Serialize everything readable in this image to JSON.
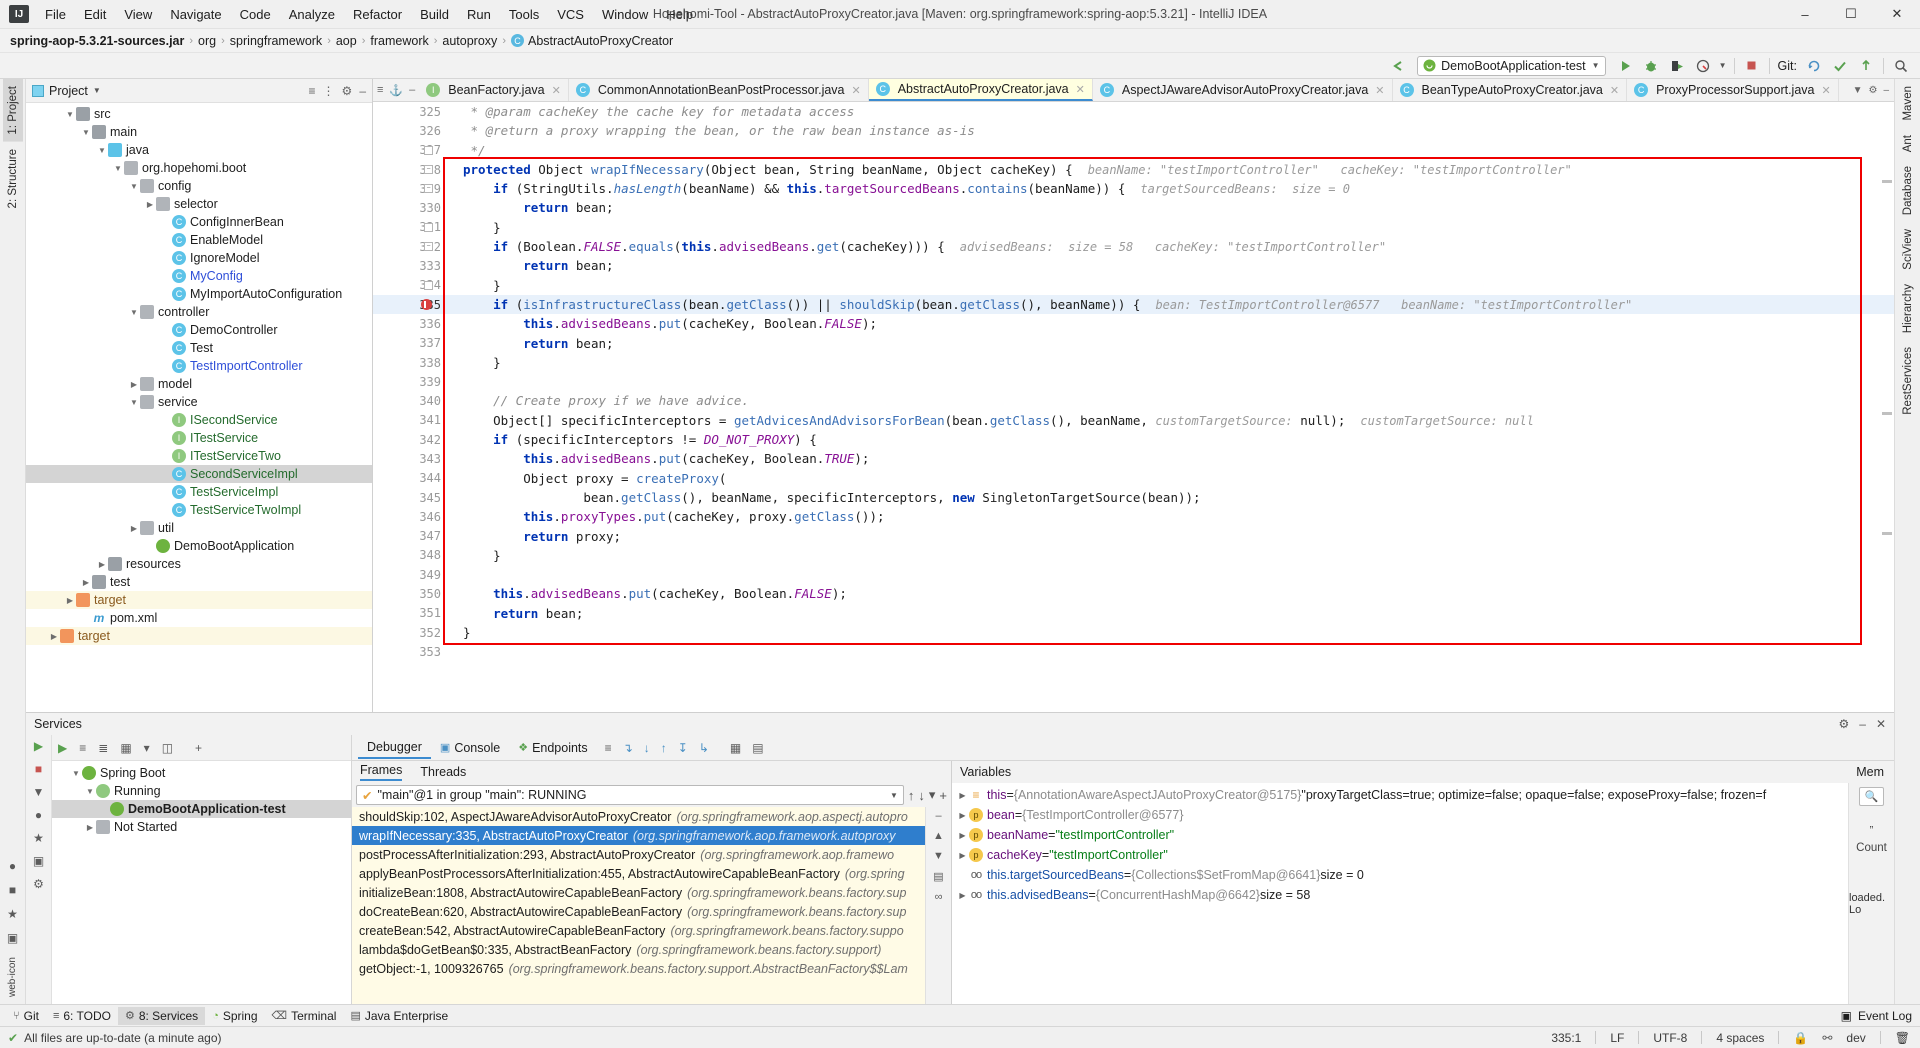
{
  "window": {
    "title": "Hopehomi-Tool - AbstractAutoProxyCreator.java [Maven: org.springframework:spring-aop:5.3.21] - IntelliJ IDEA",
    "minimize": "–",
    "maximize": "☐",
    "close": "✕"
  },
  "menu": [
    "File",
    "Edit",
    "View",
    "Navigate",
    "Code",
    "Analyze",
    "Refactor",
    "Build",
    "Run",
    "Tools",
    "VCS",
    "Window",
    "Help"
  ],
  "breadcrumb": {
    "root": "spring-aop-5.3.21-sources.jar",
    "items": [
      "org",
      "springframework",
      "aop",
      "framework",
      "autoproxy"
    ],
    "leaf": "AbstractAutoProxyCreator",
    "leaf_icon": "class-icon",
    "separator": "›"
  },
  "toolbar": {
    "run_config": "DemoBootApplication-test",
    "run_config_icon": "spring-boot-icon",
    "git_label": "Git:",
    "back_icon": "back-arrow-icon",
    "run_icon": "run-icon",
    "debug_icon": "debug-icon",
    "run_coverage_icon": "run-coverage-icon",
    "profile_icon": "profiler-icon",
    "stop_icon": "stop-icon",
    "update_icon": "update-project-icon",
    "commit_icon": "commit-icon",
    "push_icon": "push-icon",
    "search_icon": "search-everywhere-icon"
  },
  "project_pane": {
    "title": "Project",
    "caret": "▼",
    "tree": [
      {
        "label": "src",
        "indent": 2,
        "twist": "▼",
        "icon": "folder-icon",
        "color": "plain"
      },
      {
        "label": "main",
        "indent": 3,
        "twist": "▼",
        "icon": "folder-icon",
        "color": "plain"
      },
      {
        "label": "java",
        "indent": 4,
        "twist": "▼",
        "icon": "source-folder-icon",
        "color": "plain"
      },
      {
        "label": "org.hopehomi.boot",
        "indent": 5,
        "twist": "▼",
        "icon": "package-icon",
        "color": "plain"
      },
      {
        "label": "config",
        "indent": 6,
        "twist": "▼",
        "icon": "package-icon",
        "color": "plain"
      },
      {
        "label": "selector",
        "indent": 7,
        "twist": "▶",
        "icon": "package-icon",
        "color": "plain"
      },
      {
        "label": "ConfigInnerBean",
        "indent": 8,
        "twist": "",
        "icon": "class-icon",
        "color": "plain"
      },
      {
        "label": "EnableModel",
        "indent": 8,
        "twist": "",
        "icon": "class-icon",
        "color": "plain"
      },
      {
        "label": "IgnoreModel",
        "indent": 8,
        "twist": "",
        "icon": "class-icon",
        "color": "plain"
      },
      {
        "label": "MyConfig",
        "indent": 8,
        "twist": "",
        "icon": "class-icon",
        "color": "blue"
      },
      {
        "label": "MyImportAutoConfiguration",
        "indent": 8,
        "twist": "",
        "icon": "class-icon",
        "color": "plain"
      },
      {
        "label": "controller",
        "indent": 6,
        "twist": "▼",
        "icon": "package-icon",
        "color": "plain"
      },
      {
        "label": "DemoController",
        "indent": 8,
        "twist": "",
        "icon": "class-icon",
        "color": "plain"
      },
      {
        "label": "Test",
        "indent": 8,
        "twist": "",
        "icon": "class-icon",
        "color": "plain"
      },
      {
        "label": "TestImportController",
        "indent": 8,
        "twist": "",
        "icon": "class-icon",
        "color": "blue"
      },
      {
        "label": "model",
        "indent": 6,
        "twist": "▶",
        "icon": "package-icon",
        "color": "plain"
      },
      {
        "label": "service",
        "indent": 6,
        "twist": "▼",
        "icon": "package-icon",
        "color": "plain"
      },
      {
        "label": "ISecondService",
        "indent": 8,
        "twist": "",
        "icon": "interface-icon",
        "color": "green"
      },
      {
        "label": "ITestService",
        "indent": 8,
        "twist": "",
        "icon": "interface-icon",
        "color": "green"
      },
      {
        "label": "ITestServiceTwo",
        "indent": 8,
        "twist": "",
        "icon": "interface-icon",
        "color": "green"
      },
      {
        "label": "SecondServiceImpl",
        "indent": 8,
        "twist": "",
        "icon": "class-icon",
        "color": "green",
        "state": "selected"
      },
      {
        "label": "TestServiceImpl",
        "indent": 8,
        "twist": "",
        "icon": "class-icon",
        "color": "green"
      },
      {
        "label": "TestServiceTwoImpl",
        "indent": 8,
        "twist": "",
        "icon": "class-icon",
        "color": "green"
      },
      {
        "label": "util",
        "indent": 6,
        "twist": "▶",
        "icon": "package-icon",
        "color": "plain"
      },
      {
        "label": "DemoBootApplication",
        "indent": 7,
        "twist": "",
        "icon": "spring-class-icon",
        "color": "plain"
      },
      {
        "label": "resources",
        "indent": 4,
        "twist": "▶",
        "icon": "resources-folder-icon",
        "color": "plain"
      },
      {
        "label": "test",
        "indent": 3,
        "twist": "▶",
        "icon": "folder-icon",
        "color": "plain"
      },
      {
        "label": "target",
        "indent": 2,
        "twist": "▶",
        "icon": "excluded-folder-icon",
        "color": "orange",
        "state": "highlighted"
      },
      {
        "label": "pom.xml",
        "indent": 3,
        "twist": "",
        "icon": "maven-icon",
        "color": "plain"
      },
      {
        "label": "target",
        "indent": 1,
        "twist": "▶",
        "icon": "excluded-folder-icon",
        "color": "orange",
        "state": "highlighted"
      }
    ]
  },
  "editor": {
    "tabs": [
      {
        "label": "BeanFactory.java",
        "icon": "interface-icon",
        "active": false
      },
      {
        "label": "CommonAnnotationBeanPostProcessor.java",
        "icon": "class-icon",
        "active": false
      },
      {
        "label": "AbstractAutoProxyCreator.java",
        "icon": "class-icon",
        "active": true
      },
      {
        "label": "AspectJAwareAdvisorAutoProxyCreator.java",
        "icon": "class-icon",
        "active": false
      },
      {
        "label": "BeanTypeAutoProxyCreator.java",
        "icon": "class-icon",
        "active": false
      },
      {
        "label": "ProxyProcessorSupport.java",
        "icon": "class-icon",
        "active": false
      }
    ],
    "first_line": 325,
    "current_line": 335,
    "lines": [
      {
        "n": 325,
        "text": " * @param cacheKey the cache key for metadata access",
        "kind": "javadoc"
      },
      {
        "n": 326,
        "text": " * @return a proxy wrapping the bean, or the raw bean instance as-is",
        "kind": "javadoc"
      },
      {
        "n": 327,
        "text": " */",
        "kind": "javadoc"
      },
      {
        "n": 328,
        "text": "protected Object wrapIfNecessary(Object bean, String beanName, Object cacheKey) {",
        "kind": "code"
      },
      {
        "n": 329,
        "text": "    if (StringUtils.hasLength(beanName) && this.targetSourcedBeans.contains(beanName)) {",
        "kind": "code"
      },
      {
        "n": 330,
        "text": "        return bean;",
        "kind": "code"
      },
      {
        "n": 331,
        "text": "    }",
        "kind": "code"
      },
      {
        "n": 332,
        "text": "    if (Boolean.FALSE.equals(this.advisedBeans.get(cacheKey))) {",
        "kind": "code"
      },
      {
        "n": 333,
        "text": "        return bean;",
        "kind": "code"
      },
      {
        "n": 334,
        "text": "    }",
        "kind": "code"
      },
      {
        "n": 335,
        "text": "    if (isInfrastructureClass(bean.getClass()) || shouldSkip(bean.getClass(), beanName)) {",
        "kind": "code"
      },
      {
        "n": 336,
        "text": "        this.advisedBeans.put(cacheKey, Boolean.FALSE);",
        "kind": "code"
      },
      {
        "n": 337,
        "text": "        return bean;",
        "kind": "code"
      },
      {
        "n": 338,
        "text": "    }",
        "kind": "code"
      },
      {
        "n": 339,
        "text": "",
        "kind": "code"
      },
      {
        "n": 340,
        "text": "    // Create proxy if we have advice.",
        "kind": "comment"
      },
      {
        "n": 341,
        "text": "    Object[] specificInterceptors = getAdvicesAndAdvisorsForBean(bean.getClass(), beanName, customTargetSource: null);",
        "kind": "code"
      },
      {
        "n": 342,
        "text": "    if (specificInterceptors != DO_NOT_PROXY) {",
        "kind": "code"
      },
      {
        "n": 343,
        "text": "        this.advisedBeans.put(cacheKey, Boolean.TRUE);",
        "kind": "code"
      },
      {
        "n": 344,
        "text": "        Object proxy = createProxy(",
        "kind": "code"
      },
      {
        "n": 345,
        "text": "                bean.getClass(), beanName, specificInterceptors, new SingletonTargetSource(bean));",
        "kind": "code"
      },
      {
        "n": 346,
        "text": "        this.proxyTypes.put(cacheKey, proxy.getClass());",
        "kind": "code"
      },
      {
        "n": 347,
        "text": "        return proxy;",
        "kind": "code"
      },
      {
        "n": 348,
        "text": "    }",
        "kind": "code"
      },
      {
        "n": 349,
        "text": "",
        "kind": "code"
      },
      {
        "n": 350,
        "text": "    this.advisedBeans.put(cacheKey, Boolean.FALSE);",
        "kind": "code"
      },
      {
        "n": 351,
        "text": "    return bean;",
        "kind": "code"
      },
      {
        "n": 352,
        "text": "}",
        "kind": "code"
      },
      {
        "n": 353,
        "text": "",
        "kind": "code"
      }
    ],
    "inline_hints": {
      "line328": "beanName: \"testImportController\"   cacheKey: \"testImportController\"",
      "line329": "targetSourcedBeans:  size = 0",
      "line332": "advisedBeans:  size = 58   cacheKey: \"testImportController\"",
      "line335": "bean: TestImportController@6577   beanName: \"testImportController\"",
      "line341": "customTargetSource: null"
    }
  },
  "services": {
    "title": "Services",
    "tree": [
      {
        "label": "Spring Boot",
        "indent": 1,
        "twist": "▼",
        "icon": "spring-icon"
      },
      {
        "label": "Running",
        "indent": 2,
        "twist": "▼",
        "icon": "run-icon"
      },
      {
        "label": "DemoBootApplication-test",
        "indent": 3,
        "twist": "",
        "icon": "spring-boot-icon",
        "state": "selected"
      },
      {
        "label": "Not Started",
        "indent": 2,
        "twist": "▶",
        "icon": "not-started-icon"
      }
    ],
    "tabs": [
      {
        "label": "Debugger",
        "icon": "",
        "active": true
      },
      {
        "label": "Console",
        "icon": "console-icon",
        "active": false
      },
      {
        "label": "Endpoints",
        "icon": "endpoints-icon",
        "active": false
      }
    ],
    "frames": {
      "tab_frames": "Frames",
      "tab_threads": "Threads",
      "thread": "\"main\"@1 in group \"main\": RUNNING",
      "rows": [
        {
          "method": "shouldSkip:102, AspectJAwareAdvisorAutoProxyCreator",
          "pkg": "(org.springframework.aop.aspectj.autopro",
          "selected": false
        },
        {
          "method": "wrapIfNecessary:335, AbstractAutoProxyCreator",
          "pkg": "(org.springframework.aop.framework.autoproxy",
          "selected": true
        },
        {
          "method": "postProcessAfterInitialization:293, AbstractAutoProxyCreator",
          "pkg": "(org.springframework.aop.framewo",
          "selected": false
        },
        {
          "method": "applyBeanPostProcessorsAfterInitialization:455, AbstractAutowireCapableBeanFactory",
          "pkg": "(org.spring",
          "selected": false
        },
        {
          "method": "initializeBean:1808, AbstractAutowireCapableBeanFactory",
          "pkg": "(org.springframework.beans.factory.sup",
          "selected": false
        },
        {
          "method": "doCreateBean:620, AbstractAutowireCapableBeanFactory",
          "pkg": "(org.springframework.beans.factory.sup",
          "selected": false
        },
        {
          "method": "createBean:542, AbstractAutowireCapableBeanFactory",
          "pkg": "(org.springframework.beans.factory.suppo",
          "selected": false
        },
        {
          "method": "lambda$doGetBean$0:335, AbstractBeanFactory",
          "pkg": "(org.springframework.beans.factory.support)",
          "selected": false
        },
        {
          "method": "getObject:-1, 1009326765",
          "pkg": "(org.springframework.beans.factory.support.AbstractBeanFactory$$Lam",
          "selected": false
        }
      ]
    },
    "variables": {
      "title": "Variables",
      "mem_label": "Mem",
      "count_label": "Count",
      "loaded_label": "loaded. Lo",
      "rows": [
        {
          "twist": "▶",
          "icon": "this-icon",
          "name": "this",
          "eq": "=",
          "value": "{AnnotationAwareAspectJAutoProxyCreator@5175}",
          "extra": "\"proxyTargetClass=true; optimize=false; opaque=false; exposeProxy=false; frozen=f",
          "vkind": "obj"
        },
        {
          "twist": "▶",
          "icon": "param-icon",
          "name": "bean",
          "eq": "=",
          "value": "{TestImportController@6577}",
          "extra": "",
          "vkind": "obj"
        },
        {
          "twist": "▶",
          "icon": "param-icon",
          "name": "beanName",
          "eq": "=",
          "value": "\"testImportController\"",
          "extra": "",
          "vkind": "str"
        },
        {
          "twist": "▶",
          "icon": "param-icon",
          "name": "cacheKey",
          "eq": "=",
          "value": "\"testImportController\"",
          "extra": "",
          "vkind": "str"
        },
        {
          "twist": "",
          "icon": "field-icon",
          "name": "this.targetSourcedBeans",
          "eq": "=",
          "value": "{Collections$SetFromMap@6641}",
          "extra": "size = 0",
          "vkind": "obj"
        },
        {
          "twist": "▶",
          "icon": "field-icon",
          "name": "this.advisedBeans",
          "eq": "=",
          "value": "{ConcurrentHashMap@6642}",
          "extra": "size = 58",
          "vkind": "obj"
        }
      ]
    }
  },
  "tool_strip": {
    "items": [
      {
        "label": "Git",
        "icon": "git-icon",
        "active": false
      },
      {
        "label": "6: TODO",
        "icon": "todo-icon",
        "active": false
      },
      {
        "label": "8: Services",
        "icon": "services-icon",
        "active": true
      },
      {
        "label": "Spring",
        "icon": "spring-icon",
        "active": false
      },
      {
        "label": "Terminal",
        "icon": "terminal-icon",
        "active": false
      },
      {
        "label": "Java Enterprise",
        "icon": "java-ee-icon",
        "active": false
      }
    ],
    "event_log": "Event Log",
    "event_log_icon": "event-log-icon"
  },
  "statusbar": {
    "message": "All files are up-to-date (a minute ago)",
    "check_icon": "checkmark-icon",
    "caret_position": "335:1",
    "line_separator": "LF",
    "encoding": "UTF-8",
    "indent": "4 spaces",
    "branch": "dev",
    "lock_icon": "lock-icon",
    "branch_icon": "branch-icon",
    "trash_icon": "trash-icon"
  },
  "left_strip": {
    "tabs": [
      "1: Project",
      "2: Structure"
    ],
    "active": "1: Project",
    "bottom_icons": [
      "git-icon",
      "todo-icon",
      "favorites-icon",
      "camera-icon",
      "web-icon"
    ]
  },
  "right_strip": {
    "tabs": [
      "Maven",
      "Ant",
      "Database",
      "SciView",
      "Hierarchy",
      "RestServices"
    ]
  },
  "colors": {
    "accent": "#3c8bd0",
    "highlight_box": "#ef0000",
    "selected_frame": "#2f7ecd",
    "active_tab_bg": "#ffffe0",
    "breakpoint": "#d94040"
  }
}
